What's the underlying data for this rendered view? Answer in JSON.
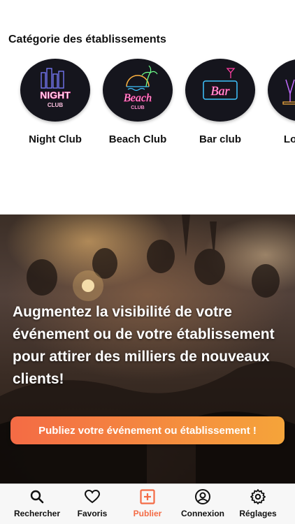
{
  "section_title": "Catégorie des établissements",
  "categories": [
    {
      "label": "Night Club",
      "sign_line1": "NIGHT",
      "sign_line2": "CLUB"
    },
    {
      "label": "Beach Club",
      "sign_line1": "Beach",
      "sign_line2": "CLUB"
    },
    {
      "label": "Bar club",
      "sign_line1": "Bar",
      "sign_line2": ""
    },
    {
      "label": "Lounge",
      "sign_line1": "",
      "sign_line2": ""
    }
  ],
  "hero": {
    "headline": "Augmentez la visibilité de votre événement ou de votre établissement pour attirer des milliers de nouveaux clients!",
    "cta_label": "Publiez votre événement ou établissement !"
  },
  "tabs": [
    {
      "label": "Rechercher",
      "icon": "search-icon"
    },
    {
      "label": "Favoris",
      "icon": "heart-icon"
    },
    {
      "label": "Publier",
      "icon": "plus-square-icon",
      "active": true
    },
    {
      "label": "Connexion",
      "icon": "user-circle-icon"
    },
    {
      "label": "Réglages",
      "icon": "gear-icon"
    }
  ],
  "colors": {
    "accent": "#f46b45",
    "accent_gradient_end": "#f5a43a",
    "neon_pink": "#ff3fa4",
    "neon_blue": "#3fc4ff",
    "tabbar_bg": "#f7f7f7"
  }
}
